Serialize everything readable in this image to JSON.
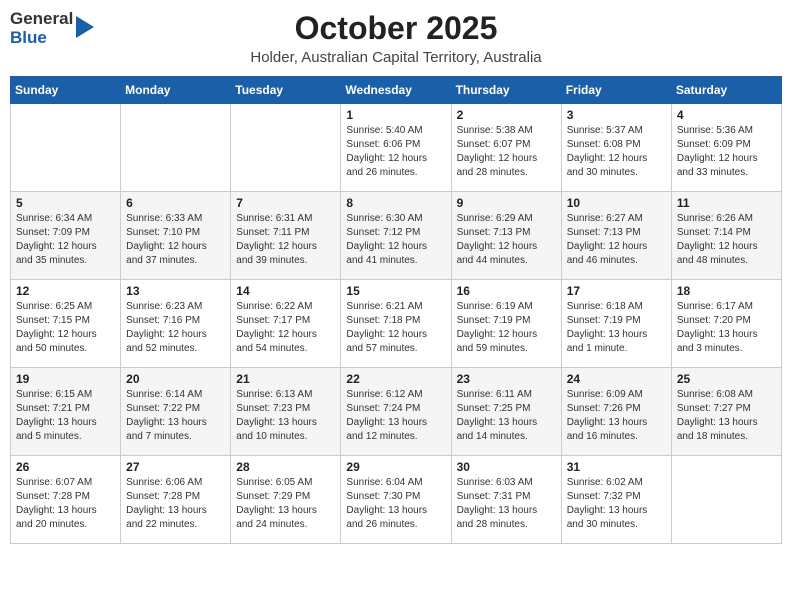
{
  "header": {
    "logo_line1": "General",
    "logo_line2": "Blue",
    "title": "October 2025",
    "subtitle": "Holder, Australian Capital Territory, Australia"
  },
  "weekdays": [
    "Sunday",
    "Monday",
    "Tuesday",
    "Wednesday",
    "Thursday",
    "Friday",
    "Saturday"
  ],
  "weeks": [
    [
      {
        "day": "",
        "info": ""
      },
      {
        "day": "",
        "info": ""
      },
      {
        "day": "",
        "info": ""
      },
      {
        "day": "1",
        "info": "Sunrise: 5:40 AM\nSunset: 6:06 PM\nDaylight: 12 hours\nand 26 minutes."
      },
      {
        "day": "2",
        "info": "Sunrise: 5:38 AM\nSunset: 6:07 PM\nDaylight: 12 hours\nand 28 minutes."
      },
      {
        "day": "3",
        "info": "Sunrise: 5:37 AM\nSunset: 6:08 PM\nDaylight: 12 hours\nand 30 minutes."
      },
      {
        "day": "4",
        "info": "Sunrise: 5:36 AM\nSunset: 6:09 PM\nDaylight: 12 hours\nand 33 minutes."
      }
    ],
    [
      {
        "day": "5",
        "info": "Sunrise: 6:34 AM\nSunset: 7:09 PM\nDaylight: 12 hours\nand 35 minutes."
      },
      {
        "day": "6",
        "info": "Sunrise: 6:33 AM\nSunset: 7:10 PM\nDaylight: 12 hours\nand 37 minutes."
      },
      {
        "day": "7",
        "info": "Sunrise: 6:31 AM\nSunset: 7:11 PM\nDaylight: 12 hours\nand 39 minutes."
      },
      {
        "day": "8",
        "info": "Sunrise: 6:30 AM\nSunset: 7:12 PM\nDaylight: 12 hours\nand 41 minutes."
      },
      {
        "day": "9",
        "info": "Sunrise: 6:29 AM\nSunset: 7:13 PM\nDaylight: 12 hours\nand 44 minutes."
      },
      {
        "day": "10",
        "info": "Sunrise: 6:27 AM\nSunset: 7:13 PM\nDaylight: 12 hours\nand 46 minutes."
      },
      {
        "day": "11",
        "info": "Sunrise: 6:26 AM\nSunset: 7:14 PM\nDaylight: 12 hours\nand 48 minutes."
      }
    ],
    [
      {
        "day": "12",
        "info": "Sunrise: 6:25 AM\nSunset: 7:15 PM\nDaylight: 12 hours\nand 50 minutes."
      },
      {
        "day": "13",
        "info": "Sunrise: 6:23 AM\nSunset: 7:16 PM\nDaylight: 12 hours\nand 52 minutes."
      },
      {
        "day": "14",
        "info": "Sunrise: 6:22 AM\nSunset: 7:17 PM\nDaylight: 12 hours\nand 54 minutes."
      },
      {
        "day": "15",
        "info": "Sunrise: 6:21 AM\nSunset: 7:18 PM\nDaylight: 12 hours\nand 57 minutes."
      },
      {
        "day": "16",
        "info": "Sunrise: 6:19 AM\nSunset: 7:19 PM\nDaylight: 12 hours\nand 59 minutes."
      },
      {
        "day": "17",
        "info": "Sunrise: 6:18 AM\nSunset: 7:19 PM\nDaylight: 13 hours\nand 1 minute."
      },
      {
        "day": "18",
        "info": "Sunrise: 6:17 AM\nSunset: 7:20 PM\nDaylight: 13 hours\nand 3 minutes."
      }
    ],
    [
      {
        "day": "19",
        "info": "Sunrise: 6:15 AM\nSunset: 7:21 PM\nDaylight: 13 hours\nand 5 minutes."
      },
      {
        "day": "20",
        "info": "Sunrise: 6:14 AM\nSunset: 7:22 PM\nDaylight: 13 hours\nand 7 minutes."
      },
      {
        "day": "21",
        "info": "Sunrise: 6:13 AM\nSunset: 7:23 PM\nDaylight: 13 hours\nand 10 minutes."
      },
      {
        "day": "22",
        "info": "Sunrise: 6:12 AM\nSunset: 7:24 PM\nDaylight: 13 hours\nand 12 minutes."
      },
      {
        "day": "23",
        "info": "Sunrise: 6:11 AM\nSunset: 7:25 PM\nDaylight: 13 hours\nand 14 minutes."
      },
      {
        "day": "24",
        "info": "Sunrise: 6:09 AM\nSunset: 7:26 PM\nDaylight: 13 hours\nand 16 minutes."
      },
      {
        "day": "25",
        "info": "Sunrise: 6:08 AM\nSunset: 7:27 PM\nDaylight: 13 hours\nand 18 minutes."
      }
    ],
    [
      {
        "day": "26",
        "info": "Sunrise: 6:07 AM\nSunset: 7:28 PM\nDaylight: 13 hours\nand 20 minutes."
      },
      {
        "day": "27",
        "info": "Sunrise: 6:06 AM\nSunset: 7:28 PM\nDaylight: 13 hours\nand 22 minutes."
      },
      {
        "day": "28",
        "info": "Sunrise: 6:05 AM\nSunset: 7:29 PM\nDaylight: 13 hours\nand 24 minutes."
      },
      {
        "day": "29",
        "info": "Sunrise: 6:04 AM\nSunset: 7:30 PM\nDaylight: 13 hours\nand 26 minutes."
      },
      {
        "day": "30",
        "info": "Sunrise: 6:03 AM\nSunset: 7:31 PM\nDaylight: 13 hours\nand 28 minutes."
      },
      {
        "day": "31",
        "info": "Sunrise: 6:02 AM\nSunset: 7:32 PM\nDaylight: 13 hours\nand 30 minutes."
      },
      {
        "day": "",
        "info": ""
      }
    ]
  ]
}
